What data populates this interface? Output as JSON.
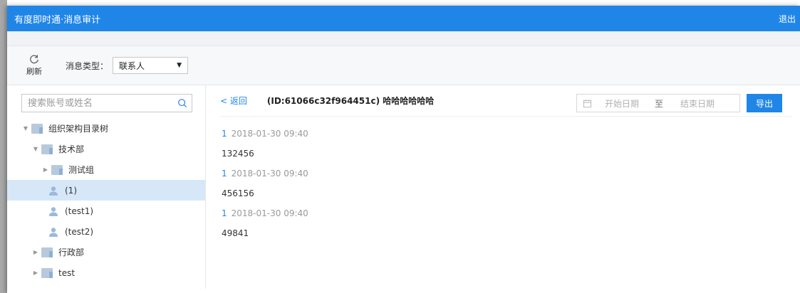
{
  "header": {
    "title": "有度即时通·消息审计",
    "logout": "退出"
  },
  "toolbar": {
    "refresh_label": "刷新",
    "type_label": "消息类型：",
    "type_value": "联系人"
  },
  "sidebar": {
    "search_placeholder": "搜索账号或姓名",
    "tree": [
      {
        "label": "组织架构目录树",
        "kind": "folder",
        "level": 0,
        "expanded": true
      },
      {
        "label": "技术部",
        "kind": "folder",
        "level": 1,
        "expanded": true
      },
      {
        "label": "测试组",
        "kind": "folder",
        "level": 2,
        "expanded": false
      },
      {
        "label": "(1)",
        "kind": "user",
        "level": 2,
        "selected": true
      },
      {
        "label": "(test1)",
        "kind": "user",
        "level": 2
      },
      {
        "label": "(test2)",
        "kind": "user",
        "level": 2
      },
      {
        "label": "行政部",
        "kind": "folder",
        "level": 1,
        "expanded": false
      },
      {
        "label": "test",
        "kind": "folder",
        "level": 1,
        "expanded": false
      }
    ]
  },
  "content": {
    "back_label": "< 返回",
    "conversation_title": "(ID:61066c32f964451c) 哈哈哈哈哈哈",
    "date_start_placeholder": "开始日期",
    "date_separator": "至",
    "date_end_placeholder": "结束日期",
    "export_label": "导出",
    "messages": [
      {
        "sender": "1",
        "time": "2018-01-30 09:40",
        "text": "132456"
      },
      {
        "sender": "1",
        "time": "2018-01-30 09:40",
        "text": "456156"
      },
      {
        "sender": "1",
        "time": "2018-01-30 09:40",
        "text": "49841"
      }
    ]
  },
  "colors": {
    "accent": "#1f86e8",
    "selected_row": "#d6e8f8",
    "folder": "#b8c9dc"
  }
}
